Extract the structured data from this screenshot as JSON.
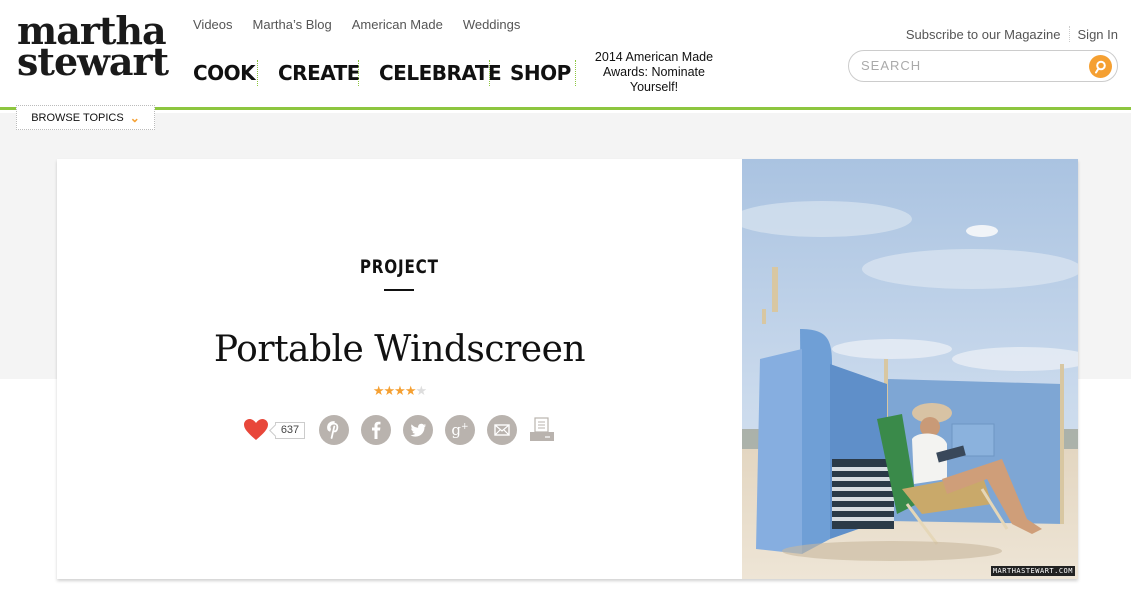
{
  "brand": {
    "line1": "martha",
    "line2": "stewart"
  },
  "top_nav": [
    "Videos",
    "Martha’s Blog",
    "American Made",
    "Weddings"
  ],
  "main_nav": [
    "COOK",
    "CREATE",
    "CELEBRATE",
    "SHOP"
  ],
  "promo": "2014 American Made Awards: Nominate Yourself!",
  "account": {
    "subscribe": "Subscribe to our Magazine",
    "sign_in": "Sign In"
  },
  "search": {
    "placeholder": "SEARCH",
    "value": ""
  },
  "browse_topics": {
    "label": "BROWSE TOPICS",
    "icon": "chevron-down-icon"
  },
  "article": {
    "kicker": "PROJECT",
    "title": "Portable Windscreen",
    "rating": {
      "value": 4,
      "max": 5
    },
    "likes": "637",
    "share_icons": [
      "heart-icon",
      "pinterest-icon",
      "facebook-icon",
      "twitter-icon",
      "google-plus-icon",
      "email-icon",
      "print-icon"
    ]
  },
  "photo": {
    "alt": "Woman reading in beach chair behind blue fabric windscreen on sand",
    "watermark": "MARTHASTEWART.COM"
  },
  "colors": {
    "accent_green": "#8dc63f",
    "accent_orange": "#f5a032",
    "heart_red": "#e8473a",
    "icon_grey": "#b9b3ae"
  }
}
